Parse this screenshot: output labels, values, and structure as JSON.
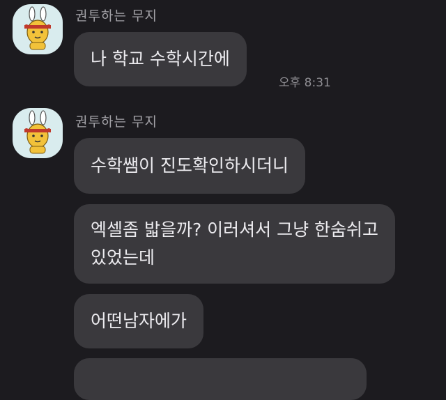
{
  "messages": [
    {
      "sender": "권투하는 무지",
      "bubbles": [
        {
          "lines": [
            "나 학교 수학시간에"
          ],
          "time": "오후 8:31"
        }
      ]
    },
    {
      "sender": "권투하는 무지",
      "bubbles": [
        {
          "lines": [
            "수학쌤이 진도확인하시더니"
          ]
        },
        {
          "lines": [
            "엑셀좀 밟을까? 이러셔서 그냥 한숨쉬고",
            "있었는데"
          ]
        },
        {
          "lines": [
            "어떤남자에가"
          ]
        }
      ]
    }
  ],
  "colors": {
    "background": "#1c1b1f",
    "bubble": "#3a393d",
    "text": "#ecebef",
    "meta": "#a4a3a8",
    "avatar_bg": "#d9ecee"
  },
  "icons": {
    "avatar": "muji-boxer-avatar-icon"
  }
}
